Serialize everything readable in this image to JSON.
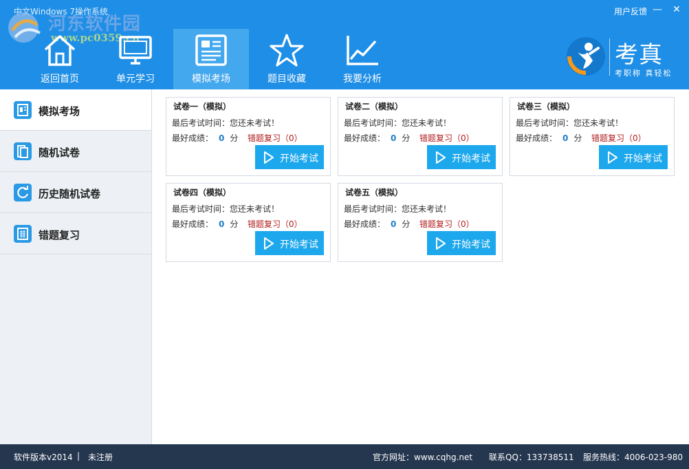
{
  "window": {
    "title": "中文Windows 7操作系统",
    "feedback": "用户反馈",
    "minimize": "—",
    "close": "✕"
  },
  "watermark": {
    "name": "河东软件园",
    "url": "www.pc0359.cn"
  },
  "nav": {
    "items": [
      {
        "label": "返回首页",
        "icon": "home-icon"
      },
      {
        "label": "单元学习",
        "icon": "monitor-icon"
      },
      {
        "label": "模拟考场",
        "icon": "document-icon",
        "active": true
      },
      {
        "label": "题目收藏",
        "icon": "star-icon"
      },
      {
        "label": "我要分析",
        "icon": "chart-icon"
      }
    ]
  },
  "brand": {
    "name": "考真",
    "slogan": "考职称 真轻松"
  },
  "sidebar": {
    "items": [
      {
        "label": "模拟考场",
        "icon": "exam-icon",
        "active": true
      },
      {
        "label": "随机试卷",
        "icon": "paper-icon"
      },
      {
        "label": "历史随机试卷",
        "icon": "history-icon"
      },
      {
        "label": "错题复习",
        "icon": "grid-icon"
      }
    ]
  },
  "cards": [
    {
      "title": "试卷一（模拟）",
      "last": "最后考试时间：您还未考试！",
      "best_label": "最好成绩：",
      "score": "0",
      "unit": "分",
      "review": "错题复习（0）",
      "button": "开始考试"
    },
    {
      "title": "试卷二（模拟）",
      "last": "最后考试时间：您还未考试！",
      "best_label": "最好成绩：",
      "score": "0",
      "unit": "分",
      "review": "错题复习（0）",
      "button": "开始考试"
    },
    {
      "title": "试卷三（模拟）",
      "last": "最后考试时间：您还未考试！",
      "best_label": "最好成绩：",
      "score": "0",
      "unit": "分",
      "review": "错题复习（0）",
      "button": "开始考试"
    },
    {
      "title": "试卷四（模拟）",
      "last": "最后考试时间：您还未考试！",
      "best_label": "最好成绩：",
      "score": "0",
      "unit": "分",
      "review": "错题复习（0）",
      "button": "开始考试"
    },
    {
      "title": "试卷五（模拟）",
      "last": "最后考试时间：您还未考试！",
      "best_label": "最好成绩：",
      "score": "0",
      "unit": "分",
      "review": "错题复习（0）",
      "button": "开始考试"
    }
  ],
  "footer": {
    "version": "软件版本v2014",
    "separator": "|",
    "register": "未注册",
    "website": "官方网址：www.cqhg.net",
    "qq": "联系QQ：133738511",
    "hotline": "服务热线：4006-023-980"
  }
}
